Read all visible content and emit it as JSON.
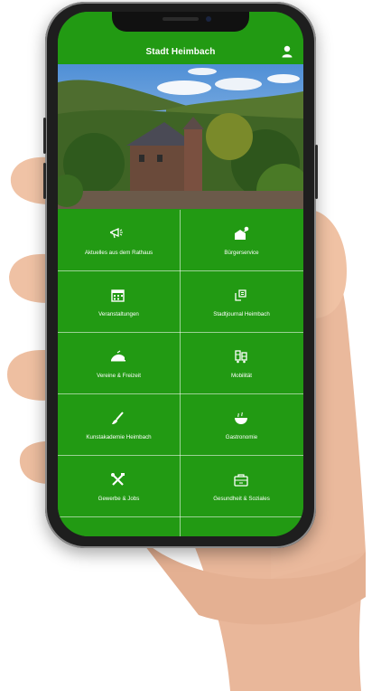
{
  "app": {
    "title": "Stadt Heimbach"
  },
  "header": {
    "icon": "user-icon"
  },
  "hero": {
    "image": "photo of Heimbach town with castle and forested hills"
  },
  "tiles": [
    {
      "label": "Aktuelles aus dem Rathaus",
      "icon": "megaphone-icon"
    },
    {
      "label": "Bürgerservice",
      "icon": "citizen-service-icon"
    },
    {
      "label": "Veranstaltungen",
      "icon": "calendar-icon"
    },
    {
      "label": "Stadtjournal Heimbach",
      "icon": "journal-icon"
    },
    {
      "label": "Vereine & Freizeit",
      "icon": "leisure-icon"
    },
    {
      "label": "Mobilität",
      "icon": "mobility-icon"
    },
    {
      "label": "Kunstakademie Heimbach",
      "icon": "brush-icon"
    },
    {
      "label": "Gastronomie",
      "icon": "food-icon"
    },
    {
      "label": "Gewerbe & Jobs",
      "icon": "tools-icon"
    },
    {
      "label": "Gesundheit & Soziales",
      "icon": "health-icon"
    }
  ],
  "colors": {
    "brand_green": "#229a13",
    "text": "#ffffff"
  }
}
